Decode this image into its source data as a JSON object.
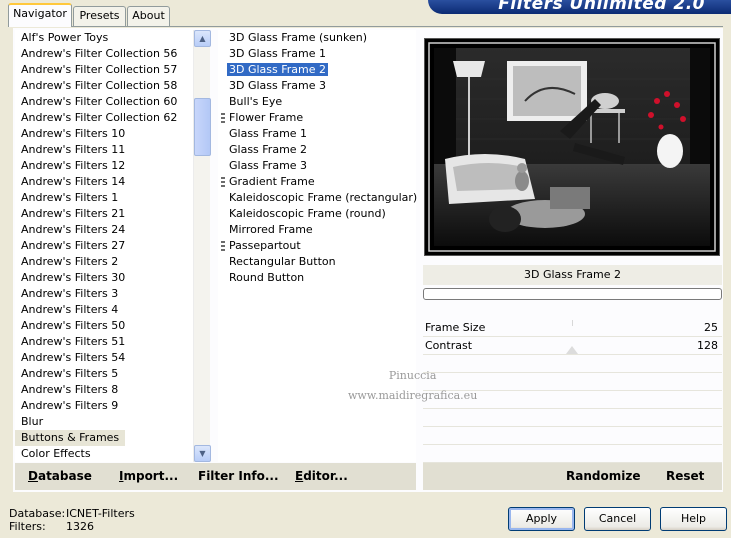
{
  "banner": {
    "title": "Filters Unlimited 2.0"
  },
  "tabs": [
    {
      "label": "Navigator"
    },
    {
      "label": "Presets"
    },
    {
      "label": "About"
    }
  ],
  "categories": {
    "items": [
      "Alf's Power Toys",
      "Andrew's Filter Collection 56",
      "Andrew's Filter Collection 57",
      "Andrew's Filter Collection 58",
      "Andrew's Filter Collection 60",
      "Andrew's Filter Collection 62",
      "Andrew's Filters 10",
      "Andrew's Filters 11",
      "Andrew's Filters 12",
      "Andrew's Filters 14",
      "Andrew's Filters 1",
      "Andrew's Filters 21",
      "Andrew's Filters 24",
      "Andrew's Filters 27",
      "Andrew's Filters 2",
      "Andrew's Filters 30",
      "Andrew's Filters 3",
      "Andrew's Filters 4",
      "Andrew's Filters 50",
      "Andrew's Filters 51",
      "Andrew's Filters 54",
      "Andrew's Filters 5",
      "Andrew's Filters 8",
      "Andrew's Filters 9",
      "Blur",
      "Buttons & Frames",
      "Color Effects"
    ],
    "selected": "Buttons & Frames"
  },
  "filters": {
    "items": [
      {
        "label": "3D Glass Frame (sunken)",
        "grip": false
      },
      {
        "label": "3D Glass Frame 1",
        "grip": false
      },
      {
        "label": "3D Glass Frame 2",
        "grip": false
      },
      {
        "label": "3D Glass Frame 3",
        "grip": false
      },
      {
        "label": "Bull's Eye",
        "grip": false
      },
      {
        "label": "Flower Frame",
        "grip": true
      },
      {
        "label": "Glass Frame 1",
        "grip": false
      },
      {
        "label": "Glass Frame 2",
        "grip": false
      },
      {
        "label": "Glass Frame 3",
        "grip": false
      },
      {
        "label": "Gradient Frame",
        "grip": true
      },
      {
        "label": "Kaleidoscopic Frame (rectangular)",
        "grip": false
      },
      {
        "label": "Kaleidoscopic Frame (round)",
        "grip": false
      },
      {
        "label": "Mirrored Frame",
        "grip": false
      },
      {
        "label": "Passepartout",
        "grip": true
      },
      {
        "label": "Rectangular Button",
        "grip": false
      },
      {
        "label": "Round Button",
        "grip": false
      }
    ],
    "selected": "3D Glass Frame 2"
  },
  "preview": {
    "filter_name": "3D Glass Frame 2",
    "progress": 0
  },
  "params": [
    {
      "label": "Frame Size",
      "value": "25"
    },
    {
      "label": "Contrast",
      "value": "128"
    }
  ],
  "toolbar_left": [
    {
      "label": "Database",
      "underline": "D",
      "rest": "atabase"
    },
    {
      "label": "Import...",
      "underline": "I",
      "rest": "mport..."
    },
    {
      "label": "Filter Info...",
      "underline": "",
      "rest": "Filter Info..."
    },
    {
      "label": "Editor...",
      "underline": "E",
      "rest": "ditor..."
    }
  ],
  "toolbar_right": {
    "randomize": "Randomize",
    "reset": "Reset"
  },
  "watermark": {
    "line1": "Pinuccia",
    "line2": "www.maidiregrafica.eu"
  },
  "status": {
    "database_label": "Database:",
    "database_value": "ICNET-Filters",
    "filters_label": "Filters:",
    "filters_value": "1326"
  },
  "buttons": {
    "apply": "Apply",
    "cancel": "Cancel",
    "help": "Help"
  }
}
